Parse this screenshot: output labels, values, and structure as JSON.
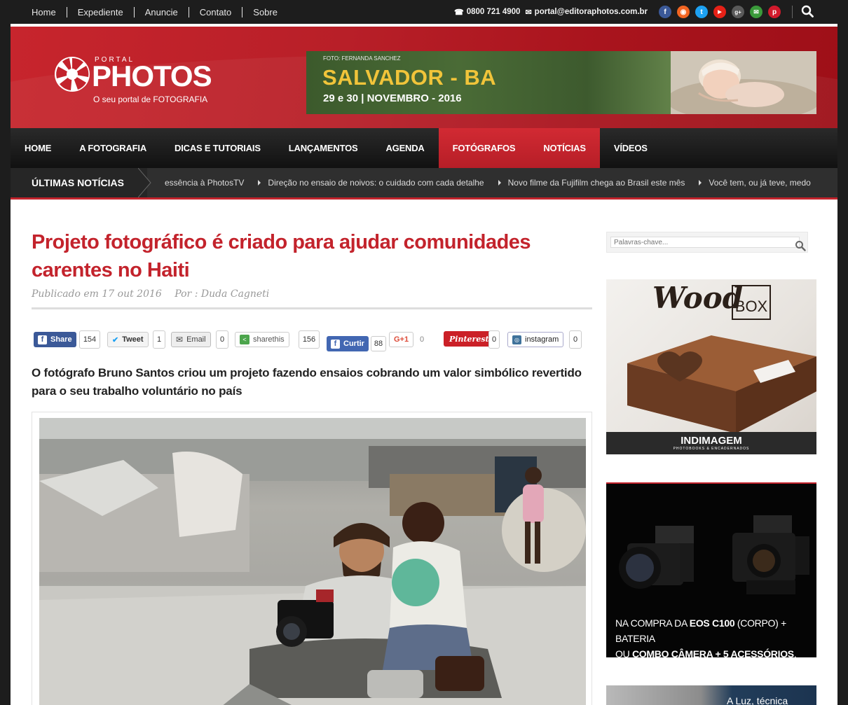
{
  "topbar": {
    "links": [
      "Home",
      "Expediente",
      "Anuncie",
      "Contato",
      "Sobre"
    ],
    "phone": "0800 721 4900",
    "email": "portal@editoraphotos.com.br",
    "social_icons": [
      "facebook-icon",
      "rss-icon",
      "twitter-icon",
      "youtube-icon",
      "google-plus-icon",
      "email-icon",
      "pinterest-icon"
    ],
    "social_colors": [
      "#3b5998",
      "#f26522",
      "#1da1f2",
      "#e62117",
      "#5a5a5a",
      "#3a9a3a",
      "#d21a2c"
    ]
  },
  "logo": {
    "portal": "PORTAL",
    "name": "PHOTOS",
    "tagline": "O seu portal de FOTOGRAFIA"
  },
  "banner": {
    "credit": "FOTO: FERNANDA SANCHEZ",
    "city": "SALVADOR - BA",
    "dates": "29 e 30 | NOVEMBRO - 2016"
  },
  "nav": {
    "items": [
      {
        "label": "HOME",
        "active": false
      },
      {
        "label": "A FOTOGRAFIA",
        "active": false
      },
      {
        "label": "DICAS E TUTORIAIS",
        "active": false
      },
      {
        "label": "LANÇAMENTOS",
        "active": false
      },
      {
        "label": "AGENDA",
        "active": false
      },
      {
        "label": "FOTÓGRAFOS",
        "active": true
      },
      {
        "label": "NOTÍCIAS",
        "active": true
      },
      {
        "label": "VÍDEOS",
        "active": false
      }
    ]
  },
  "ticker": {
    "label": "ÚLTIMAS NOTÍCIAS",
    "items": [
      "essência à PhotosTV",
      "Direção no ensaio de noivos: o cuidado com cada detalhe",
      "Novo filme da Fujifilm chega ao Brasil este mês",
      "Você tem, ou já teve, medo"
    ]
  },
  "article": {
    "title": "Projeto fotográfico é criado para ajudar comunidades carentes no Haiti",
    "published": "Publicado em 17 out 2016",
    "author": "Por : Duda Cagneti",
    "lead": "O fotógrafo Bruno Santos criou um projeto fazendo ensaios cobrando um valor simbólico revertido para o seu trabalho voluntário no país"
  },
  "share": {
    "facebook": {
      "label": "Share",
      "count": "154"
    },
    "twitter": {
      "label": "Tweet",
      "count": "1"
    },
    "email": {
      "label": "Email",
      "count": "0"
    },
    "sharethis": {
      "label": "sharethis",
      "count": "156"
    },
    "curtir": {
      "label": "Curtir",
      "count": "88"
    },
    "gplus": {
      "label": "G+1",
      "count": "0"
    },
    "pinterest": {
      "label": "Pinterest",
      "count": "0"
    },
    "instagram": {
      "label": "instagram",
      "count": "0"
    }
  },
  "sidebar": {
    "search_placeholder": "Palavras-chave...",
    "ad_woodbox": {
      "brand_script": "Wood",
      "brand_box": "BOX",
      "maker": "INDIMAGEM",
      "maker_sub": "PHOTOBOOKS & ENCADERNADOS"
    },
    "ad_canon": {
      "line1_a": "NA COMPRA DA ",
      "line1_b": "EOS C100",
      "line1_c": " (CORPO) + BATERIA",
      "line2_a": "OU ",
      "line2_b": "COMBO CÂMERA + 5 ACESSÓRIOS",
      "line2_c": ","
    },
    "ad_third": {
      "text": "A Luz, técnica"
    }
  },
  "colors": {
    "brand_red": "#c3232c",
    "topbar_bg": "#1d1d1d",
    "nav_bg": "#1a1a1a"
  }
}
